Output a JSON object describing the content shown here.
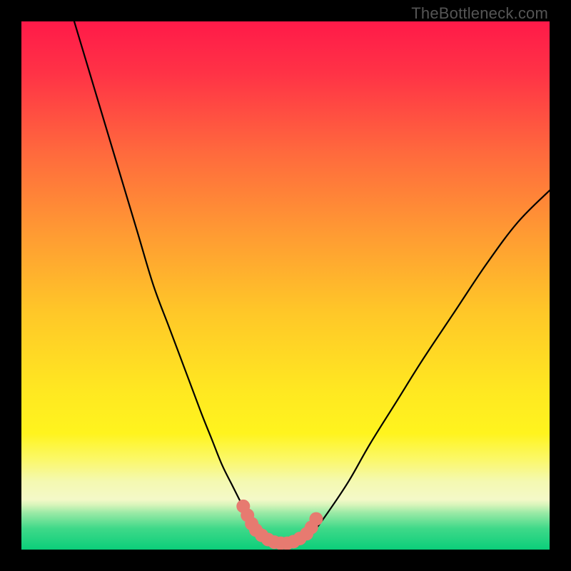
{
  "attribution": "TheBottleneck.com",
  "colors": {
    "frame": "#000000",
    "curve": "#000000",
    "marker_fill": "#e77a70",
    "marker_stroke": "#c8645b"
  },
  "chart_data": {
    "type": "line",
    "title": "",
    "xlabel": "",
    "ylabel": "",
    "xlim": [
      0,
      100
    ],
    "ylim": [
      0,
      100
    ],
    "grid": false,
    "legend": false,
    "gradient_stops": [
      {
        "offset": 0.0,
        "color": "#ff1a49"
      },
      {
        "offset": 0.1,
        "color": "#ff3346"
      },
      {
        "offset": 0.25,
        "color": "#ff6a3d"
      },
      {
        "offset": 0.4,
        "color": "#ff9a33"
      },
      {
        "offset": 0.55,
        "color": "#ffc728"
      },
      {
        "offset": 0.7,
        "color": "#ffe821"
      },
      {
        "offset": 0.78,
        "color": "#fff41e"
      },
      {
        "offset": 0.83,
        "color": "#fbf86a"
      },
      {
        "offset": 0.87,
        "color": "#f4f9b0"
      },
      {
        "offset": 0.905,
        "color": "#f4f9c8"
      },
      {
        "offset": 0.915,
        "color": "#d9f5bb"
      },
      {
        "offset": 0.93,
        "color": "#9ceaa6"
      },
      {
        "offset": 0.96,
        "color": "#3fd989"
      },
      {
        "offset": 1.0,
        "color": "#0bce7a"
      }
    ],
    "series": [
      {
        "name": "bottleneck-curve",
        "x": [
          10,
          13,
          16,
          19,
          22,
          25,
          28,
          31,
          34,
          36,
          38,
          40,
          42,
          43.5,
          45,
          47,
          49,
          51,
          53,
          55,
          58,
          62,
          66,
          71,
          76,
          82,
          88,
          94,
          100
        ],
        "y": [
          100,
          90,
          80,
          70,
          60,
          50,
          42,
          34,
          26,
          21,
          16,
          12,
          8,
          5,
          3,
          1.5,
          1,
          1,
          1.5,
          3,
          7,
          13,
          20,
          28,
          36,
          45,
          54,
          62,
          68
        ]
      }
    ],
    "markers": {
      "name": "highlight-points",
      "x": [
        42.0,
        42.8,
        43.6,
        44.4,
        45.5,
        46.7,
        47.9,
        49.1,
        50.3,
        51.5,
        52.7,
        54.0,
        54.9,
        55.8
      ],
      "y": [
        8.2,
        6.5,
        4.9,
        3.7,
        2.7,
        1.9,
        1.4,
        1.2,
        1.2,
        1.5,
        2.1,
        3.0,
        4.2,
        5.8
      ]
    }
  }
}
